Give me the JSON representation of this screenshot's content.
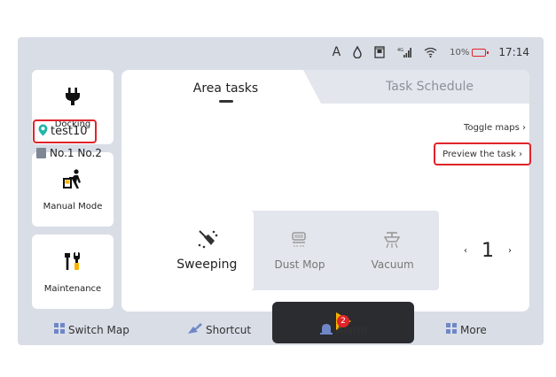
{
  "status_bar": {
    "a_label": "A",
    "battery_percent": "10%",
    "time": "17:14",
    "battery_color": "#e0242a"
  },
  "sidebar": {
    "items": [
      {
        "label": "Docking",
        "icon": "docking-plug-icon"
      },
      {
        "label": "Manual Mode",
        "icon": "manual-push-icon"
      },
      {
        "label": "Maintenance",
        "icon": "tools-icon"
      }
    ]
  },
  "tabs": [
    {
      "label": "Area tasks",
      "active": true
    },
    {
      "label": "Task Schedule",
      "active": false
    }
  ],
  "task": {
    "map_name": "test10",
    "areas": "No.1 No.2",
    "toggle_maps": "Toggle maps",
    "preview_task": "Preview the task"
  },
  "modes": [
    {
      "label": "Sweeping",
      "selected": true,
      "icon": "sweeping-icon"
    },
    {
      "label": "Dust Mop",
      "selected": false,
      "icon": "dust-mop-icon"
    },
    {
      "label": "Vacuum",
      "selected": false,
      "icon": "vacuum-icon"
    }
  ],
  "counter": {
    "value": "1",
    "left": "‹",
    "right": "›"
  },
  "bottom_nav": [
    {
      "label": "Switch Map",
      "icon": "map-grid-icon"
    },
    {
      "label": "Shortcut",
      "icon": "shortcut-icon"
    },
    {
      "label": "Alarm",
      "icon": "alarm-icon",
      "badge": "2"
    },
    {
      "label": "More",
      "icon": "more-grid-icon"
    }
  ],
  "colors": {
    "accent_red": "#e0242a",
    "play_yellow": "#f5b400",
    "pin_green": "#21b6a8"
  }
}
